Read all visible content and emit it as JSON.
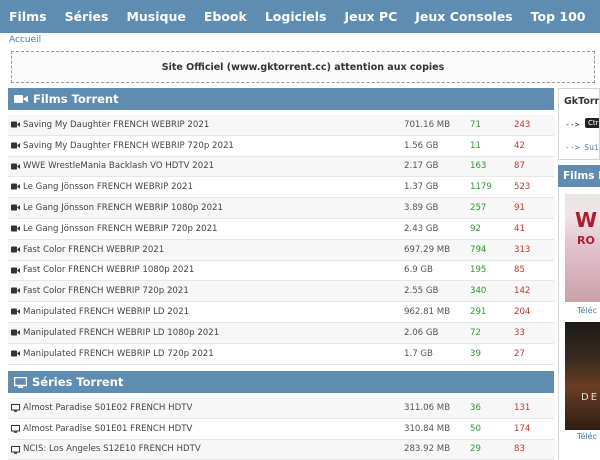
{
  "nav": [
    "Films",
    "Séries",
    "Musique",
    "Ebook",
    "Logiciels",
    "Jeux PC",
    "Jeux Consoles",
    "Top 100"
  ],
  "breadcrumb": "Accueil",
  "notice": "Site Officiel (www.gktorrent.cc) attention aux copies",
  "films": {
    "title": "Films Torrent",
    "rows": [
      {
        "name": "Saving My Daughter FRENCH WEBRIP 2021",
        "size": "701.16 MB",
        "seeders": "71",
        "leechers": "243"
      },
      {
        "name": "Saving My Daughter FRENCH WEBRIP 720p 2021",
        "size": "1.56 GB",
        "seeders": "11",
        "leechers": "42"
      },
      {
        "name": "WWE WrestleMania Backlash VO HDTV 2021",
        "size": "2.17 GB",
        "seeders": "163",
        "leechers": "87"
      },
      {
        "name": "Le Gang Jönsson FRENCH WEBRIP 2021",
        "size": "1.37 GB",
        "seeders": "1179",
        "leechers": "523"
      },
      {
        "name": "Le Gang Jönsson FRENCH WEBRIP 1080p 2021",
        "size": "3.89 GB",
        "seeders": "257",
        "leechers": "91"
      },
      {
        "name": "Le Gang Jönsson FRENCH WEBRIP 720p 2021",
        "size": "2.43 GB",
        "seeders": "92",
        "leechers": "41"
      },
      {
        "name": "Fast Color FRENCH WEBRIP 2021",
        "size": "697.29 MB",
        "seeders": "794",
        "leechers": "313"
      },
      {
        "name": "Fast Color FRENCH WEBRIP 1080p 2021",
        "size": "6.9 GB",
        "seeders": "195",
        "leechers": "85"
      },
      {
        "name": "Fast Color FRENCH WEBRIP 720p 2021",
        "size": "2.55 GB",
        "seeders": "340",
        "leechers": "142"
      },
      {
        "name": "Manipulated FRENCH WEBRIP LD 2021",
        "size": "962.81 MB",
        "seeders": "291",
        "leechers": "204"
      },
      {
        "name": "Manipulated FRENCH WEBRIP LD 1080p 2021",
        "size": "2.06 GB",
        "seeders": "72",
        "leechers": "33"
      },
      {
        "name": "Manipulated FRENCH WEBRIP LD 720p 2021",
        "size": "1.7 GB",
        "seeders": "39",
        "leechers": "27"
      }
    ]
  },
  "series": {
    "title": "Séries Torrent",
    "rows": [
      {
        "name": "Almost Paradise S01E02 FRENCH HDTV",
        "size": "311.06 MB",
        "seeders": "36",
        "leechers": "131"
      },
      {
        "name": "Almost Paradise S01E01 FRENCH HDTV",
        "size": "310.84 MB",
        "seeders": "50",
        "leechers": "174"
      },
      {
        "name": "NCIS: Los Angeles S12E10 FRENCH HDTV",
        "size": "283.92 MB",
        "seeders": "29",
        "leechers": "83"
      }
    ]
  },
  "sidebar": {
    "box_title": "GkTorre",
    "line1_prefix": "-->",
    "kbd": "Ctrl",
    "line2": "--> Suiv",
    "films_title": "Films H",
    "poster1_text_big": "W",
    "poster1_text_small": "RO",
    "poster2_text": "DE",
    "link1": "Téléc",
    "link2": "Téléc"
  },
  "colors": {
    "header_blue": "#5f8db2",
    "seeders_green": "#2e9a2e",
    "leechers_red": "#c0392b"
  }
}
